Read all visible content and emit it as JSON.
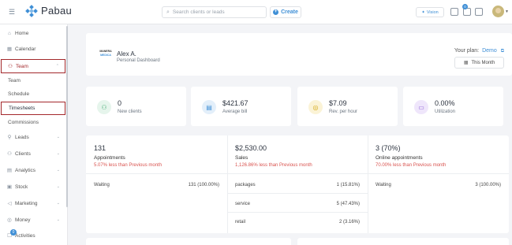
{
  "app": {
    "name": "Pabau"
  },
  "topbar": {
    "search_placeholder": "Search clients or leads",
    "create_label": "Create",
    "vision_label": "Vision",
    "notification_count": "0"
  },
  "sidebar": {
    "items": [
      {
        "label": "Home",
        "icon": "home-icon"
      },
      {
        "label": "Calendar",
        "icon": "calendar-icon"
      },
      {
        "label": "Team",
        "icon": "team-icon"
      },
      {
        "label": "Team"
      },
      {
        "label": "Schedule"
      },
      {
        "label": "Timesheets"
      },
      {
        "label": "Commissions"
      },
      {
        "label": "Leads",
        "icon": "leads-icon"
      },
      {
        "label": "Clients",
        "icon": "clients-icon"
      },
      {
        "label": "Analytics",
        "icon": "analytics-icon"
      },
      {
        "label": "Stock",
        "icon": "stock-icon"
      },
      {
        "label": "Marketing",
        "icon": "marketing-icon"
      },
      {
        "label": "Money",
        "icon": "money-icon"
      },
      {
        "label": "Activities",
        "icon": "activities-icon"
      }
    ],
    "activities_badge": "0"
  },
  "header": {
    "logo_top": "MANERA",
    "logo_bottom": "MEDICA",
    "user_name": "Alex A.",
    "subtitle": "Personal Dashboard",
    "plan_label": "Your plan:",
    "plan_value": "Demo",
    "period_label": "This Month"
  },
  "stats": [
    {
      "value": "0",
      "label": "New clients",
      "icon": "users-icon",
      "color": "#4caf7a"
    },
    {
      "value": "$421.67",
      "label": "Average bill",
      "icon": "invoice-icon",
      "color": "#3f8fd6"
    },
    {
      "value": "$7.09",
      "label": "Rev. per hour",
      "icon": "coins-icon",
      "color": "#d4a814"
    },
    {
      "value": "0.00%",
      "label": "Utilization",
      "icon": "folder-icon",
      "color": "#8e62d9"
    }
  ],
  "summary": [
    {
      "value": "131",
      "name": "Appointments",
      "diff": "5.07% less than Previous month",
      "rows": [
        {
          "label": "Waiting",
          "value": "131 (100.00%)"
        }
      ]
    },
    {
      "value": "$2,530.00",
      "name": "Sales",
      "diff": "1,126.86% less than Previous month",
      "rows": [
        {
          "label": "packages",
          "value": "1 (15.81%)"
        },
        {
          "label": "service",
          "value": "5 (47.43%)"
        },
        {
          "label": "retail",
          "value": "2 (3.16%)"
        }
      ]
    },
    {
      "value": "3 (70%)",
      "name": "Online appointments",
      "diff": "70.00% less than Previous month",
      "rows": [
        {
          "label": "Waiting",
          "value": "3 (100.00%)"
        }
      ]
    }
  ]
}
